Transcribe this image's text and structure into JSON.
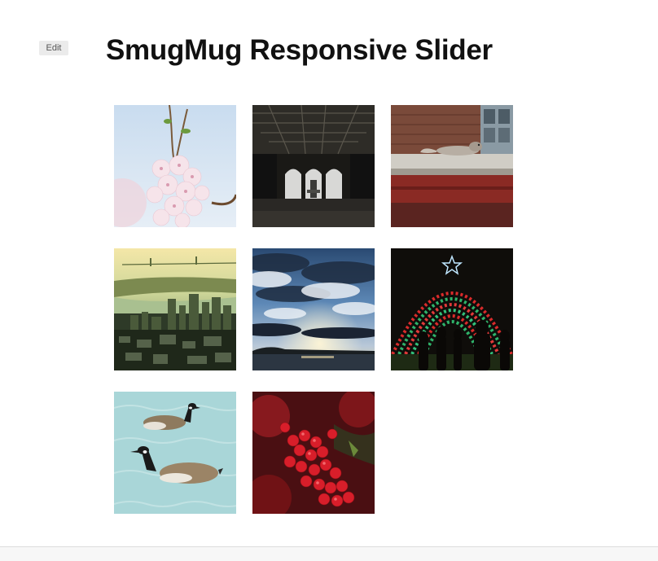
{
  "page": {
    "title": "SmugMug Responsive Slider",
    "edit_label": "Edit"
  },
  "gallery": {
    "photos": [
      {
        "subject": "cherry blossoms"
      },
      {
        "subject": "arched tunnel with fountain"
      },
      {
        "subject": "squirrel on ledge"
      },
      {
        "subject": "city skyline with bridge"
      },
      {
        "subject": "sunset clouds over lake"
      },
      {
        "subject": "holiday light tunnel"
      },
      {
        "subject": "geese swimming"
      },
      {
        "subject": "red berries"
      }
    ]
  },
  "colors": {
    "title_text": "#111111",
    "edit_button_bg": "#ebebeb",
    "footer_bg": "#f7f7f7"
  }
}
